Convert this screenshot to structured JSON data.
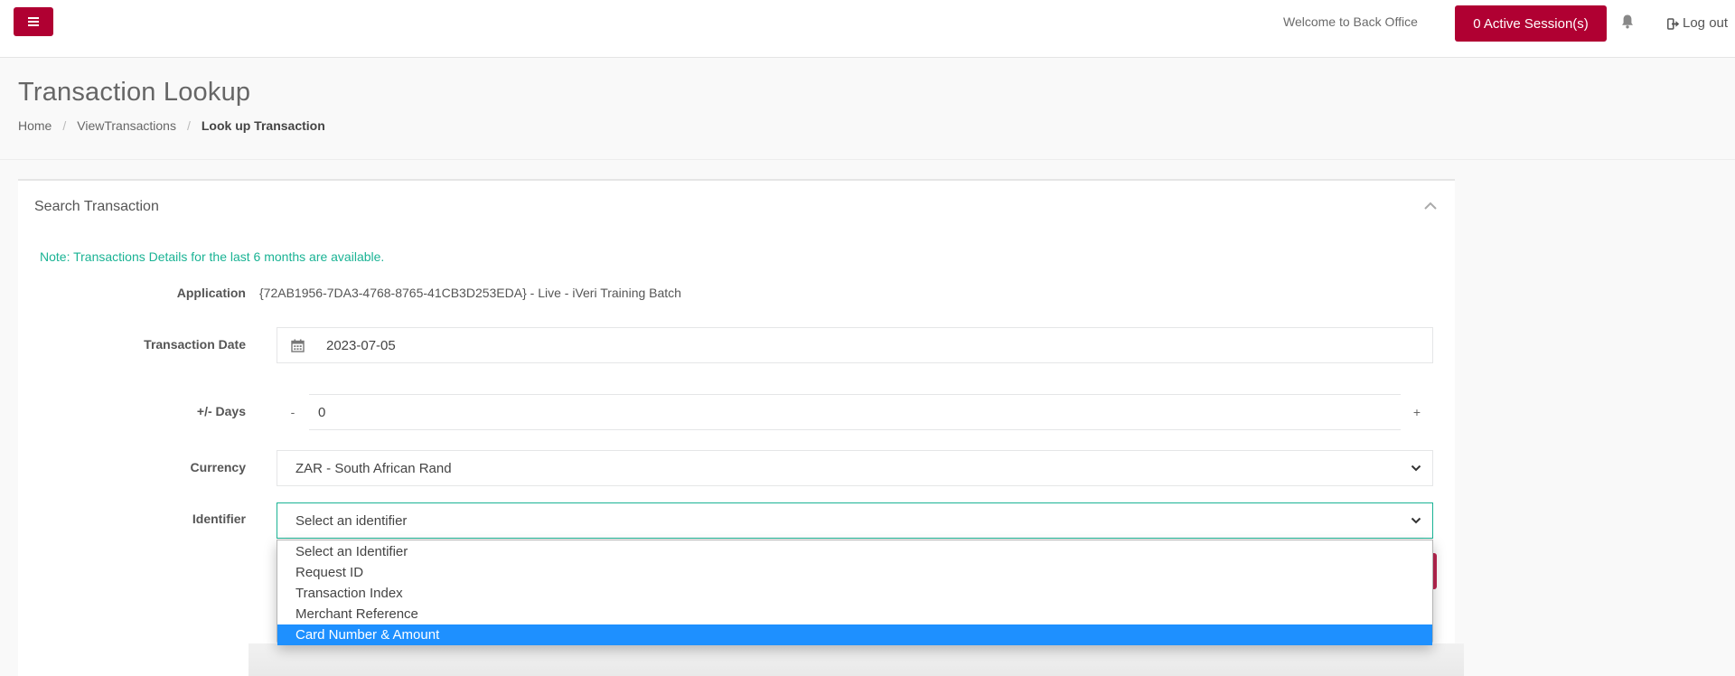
{
  "header": {
    "welcome_text": "Welcome to Back Office",
    "sessions_label": "0 Active Session(s)",
    "logout_label": "Log out",
    "menu_icon": "hamburger-icon",
    "notification_icon": "bell-icon",
    "brand_color": "#b00032"
  },
  "page": {
    "title": "Transaction Lookup",
    "breadcrumb": [
      {
        "label": "Home"
      },
      {
        "label": "ViewTransactions"
      },
      {
        "label": "Look up Transaction"
      }
    ]
  },
  "panel": {
    "title": "Search Transaction",
    "note": "Note: Transactions Details for the last 6 months are available.",
    "note_color": "#1ab394"
  },
  "form": {
    "application": {
      "label": "Application",
      "value": "{72AB1956-7DA3-4768-8765-41CB3D253EDA} - Live - iVeri Training Batch"
    },
    "transaction_date": {
      "label": "Transaction Date",
      "value": "2023-07-05"
    },
    "days": {
      "label": "+/- Days",
      "minus": "-",
      "value": "0",
      "plus": "+"
    },
    "currency": {
      "label": "Currency",
      "selected": "ZAR - South African Rand"
    },
    "identifier": {
      "label": "Identifier",
      "selected": "Select an identifier",
      "options": [
        "Select an Identifier",
        "Request ID",
        "Transaction Index",
        "Merchant Reference",
        "Card Number & Amount"
      ],
      "highlighted_option": "Card Number & Amount",
      "highlight_color": "#1e90ff"
    }
  }
}
